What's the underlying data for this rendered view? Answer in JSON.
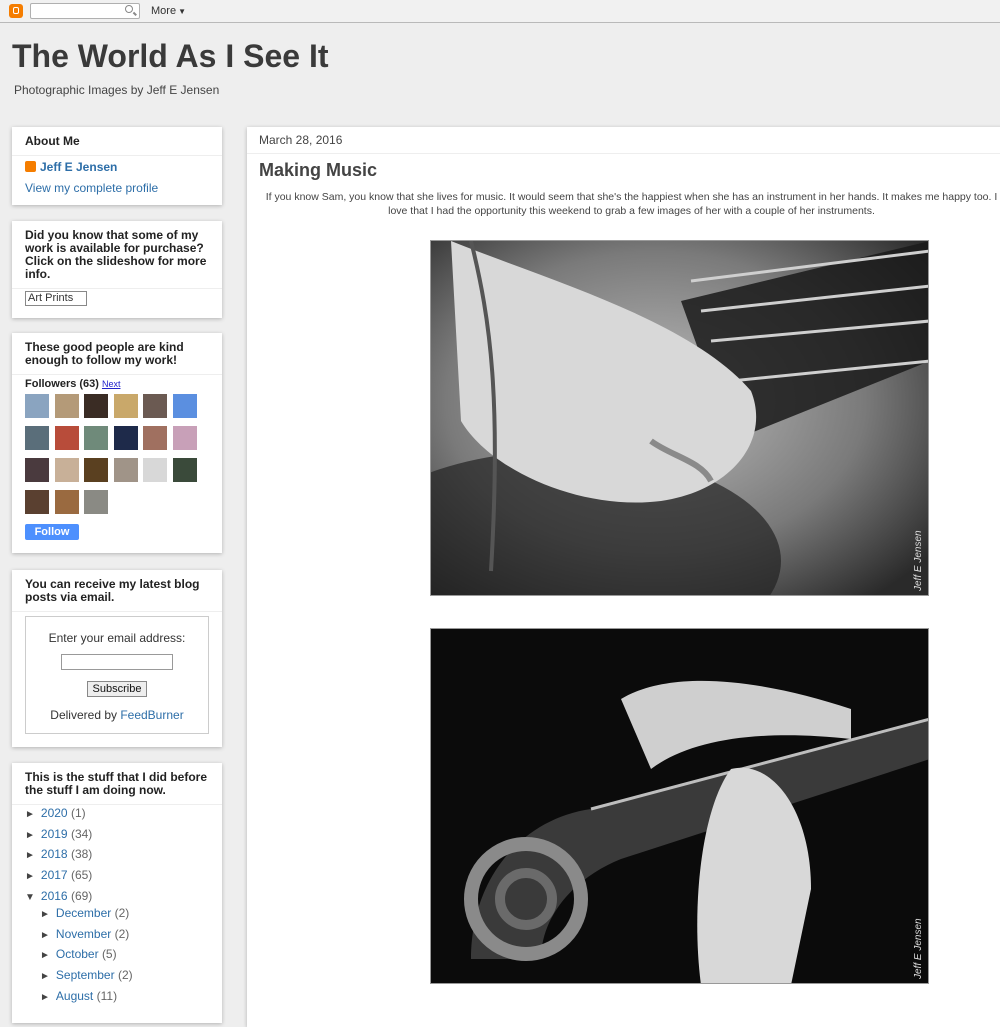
{
  "navbar": {
    "more_label": "More"
  },
  "header": {
    "title": "The World As I See It",
    "description": "Photographic Images by Jeff E Jensen"
  },
  "sidebar": {
    "about": {
      "heading": "About Me",
      "name": "Jeff E Jensen",
      "profile_link": "View my complete profile"
    },
    "prints": {
      "heading": "Did you know that some of my work is available for purchase? Click on the slideshow for more info.",
      "image_alt": "Art Prints"
    },
    "followers": {
      "heading": "These good people are kind enough to follow my work!",
      "label": "Followers (63)",
      "next_label": "Next",
      "follow_button": "Follow",
      "avatar_colors": [
        "#8aa4c0",
        "#b49a78",
        "#3a2c24",
        "#c9a86a",
        "#6b5a52",
        "#5b8fe0",
        "#5a6e7a",
        "#b84c3a",
        "#6f8a7a",
        "#1e2a4a",
        "#a07060",
        "#c8a0b8",
        "#4a3a3e",
        "#c8b098",
        "#5a4020",
        "#a09488",
        "#d8d8d8",
        "#3a4a3a",
        "#5a4030",
        "#9a6a40",
        "#8a8a84"
      ]
    },
    "email": {
      "heading": "You can receive my latest blog posts via email.",
      "label": "Enter your email address:",
      "button": "Subscribe",
      "delivered_prefix": "Delivered by ",
      "delivered_link": "FeedBurner"
    },
    "archive": {
      "heading": "This is the stuff that I did before the stuff I am doing now.",
      "years": [
        {
          "label": "2020",
          "count": "(1)",
          "marker": "►"
        },
        {
          "label": "2019",
          "count": "(34)",
          "marker": "►"
        },
        {
          "label": "2018",
          "count": "(38)",
          "marker": "►"
        },
        {
          "label": "2017",
          "count": "(65)",
          "marker": "►"
        },
        {
          "label": "2016",
          "count": "(69)",
          "marker": "▼"
        }
      ],
      "months": [
        {
          "label": "December",
          "count": "(2)",
          "marker": "►"
        },
        {
          "label": "November",
          "count": "(2)",
          "marker": "►"
        },
        {
          "label": "October",
          "count": "(5)",
          "marker": "►"
        },
        {
          "label": "September",
          "count": "(2)",
          "marker": "►"
        },
        {
          "label": "August",
          "count": "(11)",
          "marker": "►"
        }
      ]
    }
  },
  "post": {
    "date": "March 28, 2016",
    "title": "Making Music",
    "body": "If you know Sam, you know that she lives for music.  It would seem that she's the happiest when she has an instrument in her hands.  It makes me happy too.  I love that I had the opportunity this weekend to grab a few images of her with a couple of her instruments.",
    "watermark": "Jeff E Jensen"
  },
  "colors": {
    "link": "#2d6ea8",
    "accent": "#f57d00",
    "follow": "#4d90fe"
  }
}
